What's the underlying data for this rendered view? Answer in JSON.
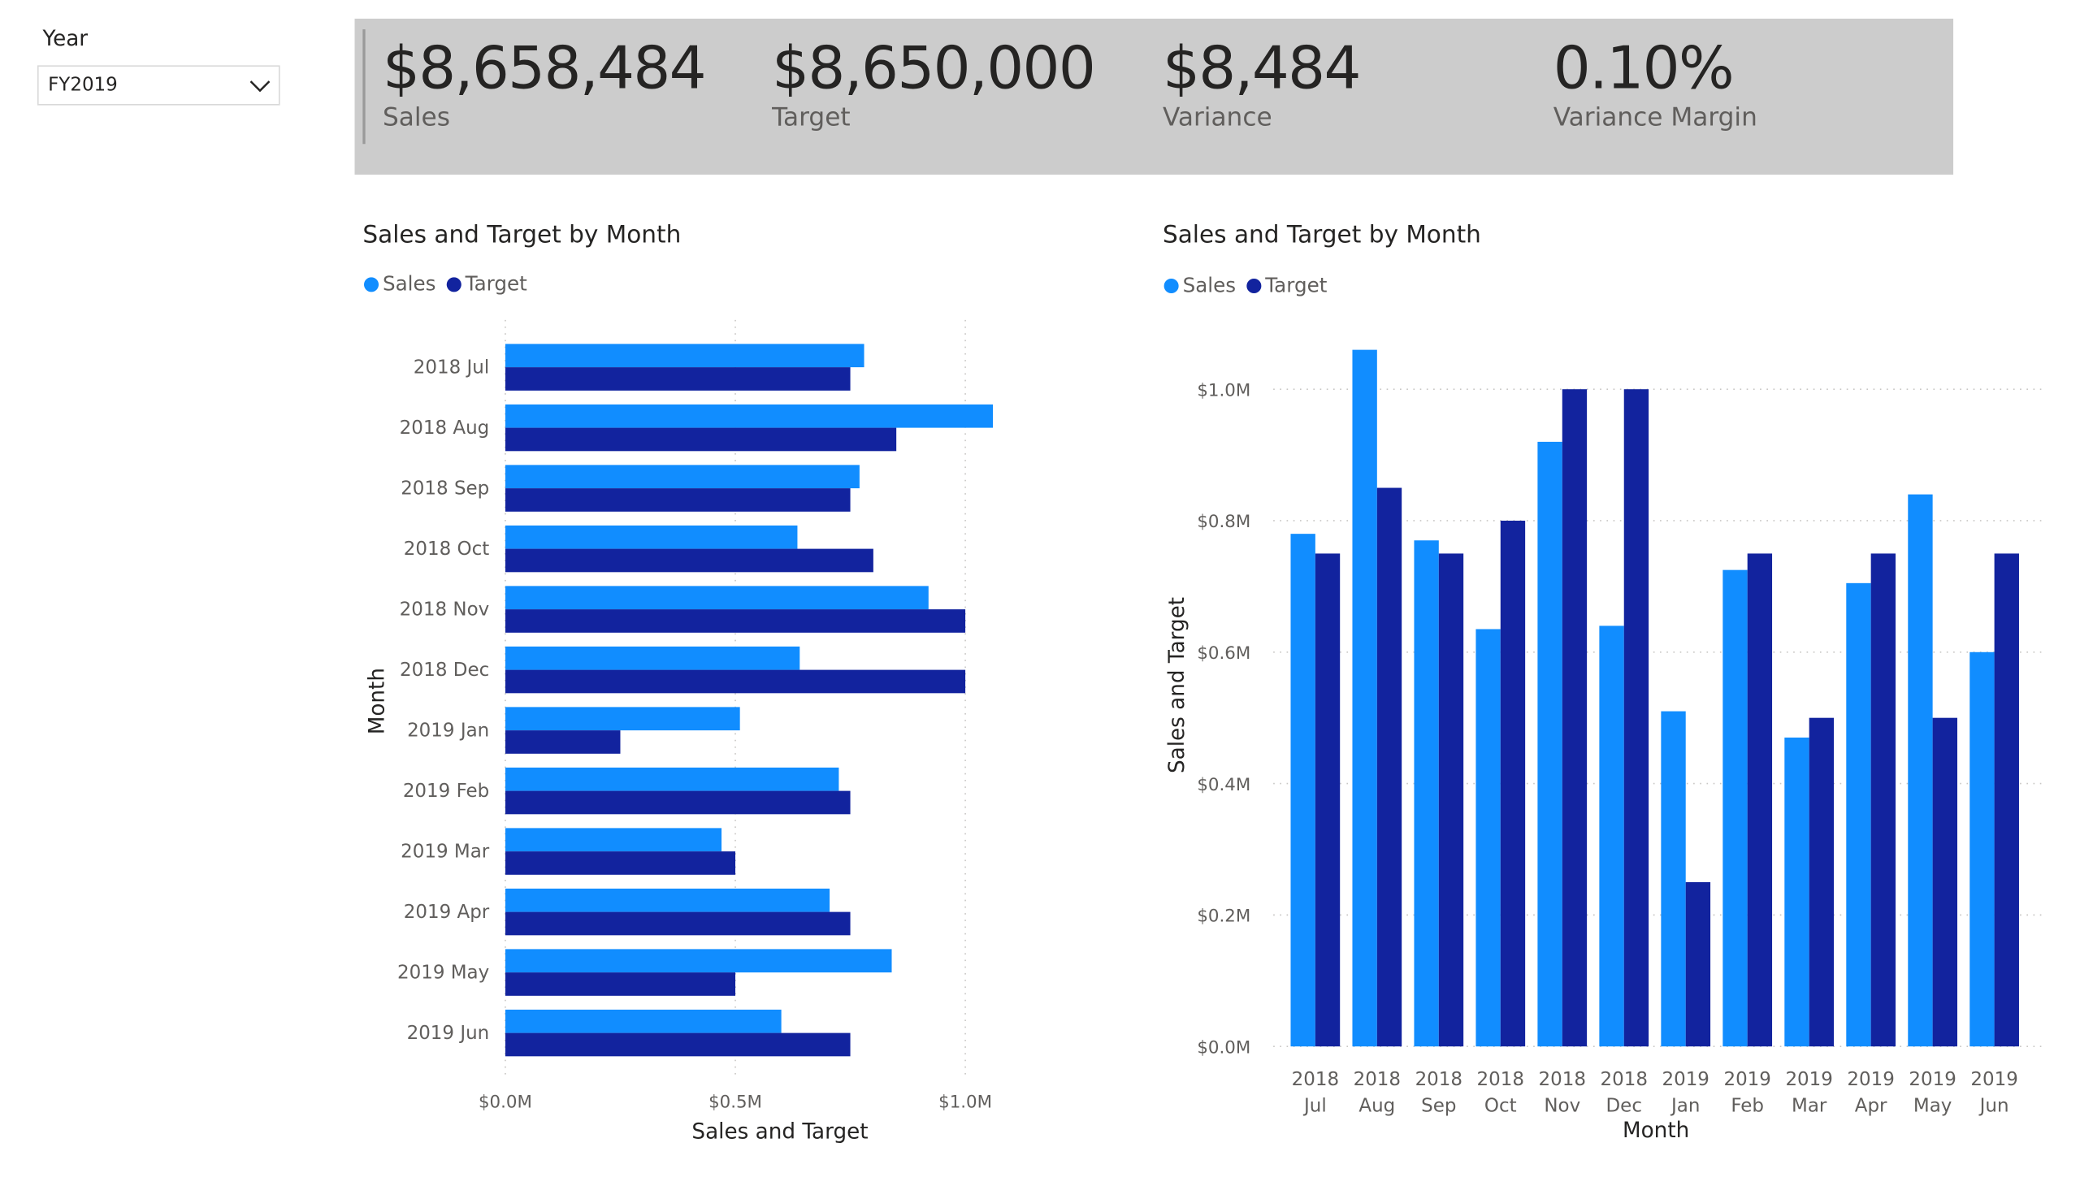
{
  "slicer": {
    "title": "Year",
    "selected": "FY2019"
  },
  "kpis": [
    {
      "value": "$8,658,484",
      "label": "Sales"
    },
    {
      "value": "$8,650,000",
      "label": "Target"
    },
    {
      "value": "$8,484",
      "label": "Variance"
    },
    {
      "value": "0.10%",
      "label": "Variance Margin"
    }
  ],
  "colors": {
    "sales": "#118DFF",
    "target": "#12239E",
    "kpi_band": "#CCCCCC",
    "grid": "#C8C6C4"
  },
  "chart_data": [
    {
      "type": "bar",
      "orientation": "horizontal",
      "title": "Sales and Target by Month",
      "xlabel": "Sales and Target",
      "ylabel": "Month",
      "categories": [
        "2018 Jul",
        "2018 Aug",
        "2018 Sep",
        "2018 Oct",
        "2018 Nov",
        "2018 Dec",
        "2019 Jan",
        "2019 Feb",
        "2019 Mar",
        "2019 Apr",
        "2019 May",
        "2019 Jun"
      ],
      "series": [
        {
          "name": "Sales",
          "values": [
            0.78,
            1.06,
            0.77,
            0.635,
            0.92,
            0.64,
            0.51,
            0.725,
            0.47,
            0.705,
            0.84,
            0.6
          ]
        },
        {
          "name": "Target",
          "values": [
            0.75,
            0.85,
            0.75,
            0.8,
            1.0,
            1.0,
            0.25,
            0.75,
            0.5,
            0.75,
            0.5,
            0.75
          ]
        }
      ],
      "xlim": [
        0,
        1.0
      ],
      "ticks": [
        "$0.0M",
        "$0.5M",
        "$1.0M"
      ],
      "tick_values": [
        0,
        0.5,
        1.0
      ],
      "units": "M",
      "grid": true,
      "legend": "top-left"
    },
    {
      "type": "bar",
      "orientation": "vertical",
      "title": "Sales and Target by Month",
      "xlabel": "Month",
      "ylabel": "Sales and Target",
      "categories": [
        [
          "2018",
          "Jul"
        ],
        [
          "2018",
          "Aug"
        ],
        [
          "2018",
          "Sep"
        ],
        [
          "2018",
          "Oct"
        ],
        [
          "2018",
          "Nov"
        ],
        [
          "2018",
          "Dec"
        ],
        [
          "2019",
          "Jan"
        ],
        [
          "2019",
          "Feb"
        ],
        [
          "2019",
          "Mar"
        ],
        [
          "2019",
          "Apr"
        ],
        [
          "2019",
          "May"
        ],
        [
          "2019",
          "Jun"
        ]
      ],
      "series": [
        {
          "name": "Sales",
          "values": [
            0.78,
            1.06,
            0.77,
            0.635,
            0.92,
            0.64,
            0.51,
            0.725,
            0.47,
            0.705,
            0.84,
            0.6
          ]
        },
        {
          "name": "Target",
          "values": [
            0.75,
            0.85,
            0.75,
            0.8,
            1.0,
            1.0,
            0.25,
            0.75,
            0.5,
            0.75,
            0.5,
            0.75
          ]
        }
      ],
      "ylim": [
        0,
        1.0
      ],
      "ticks": [
        "$0.0M",
        "$0.2M",
        "$0.4M",
        "$0.6M",
        "$0.8M",
        "$1.0M"
      ],
      "tick_values": [
        0,
        0.2,
        0.4,
        0.6,
        0.8,
        1.0
      ],
      "units": "M",
      "grid": true,
      "legend": "top-left"
    }
  ]
}
